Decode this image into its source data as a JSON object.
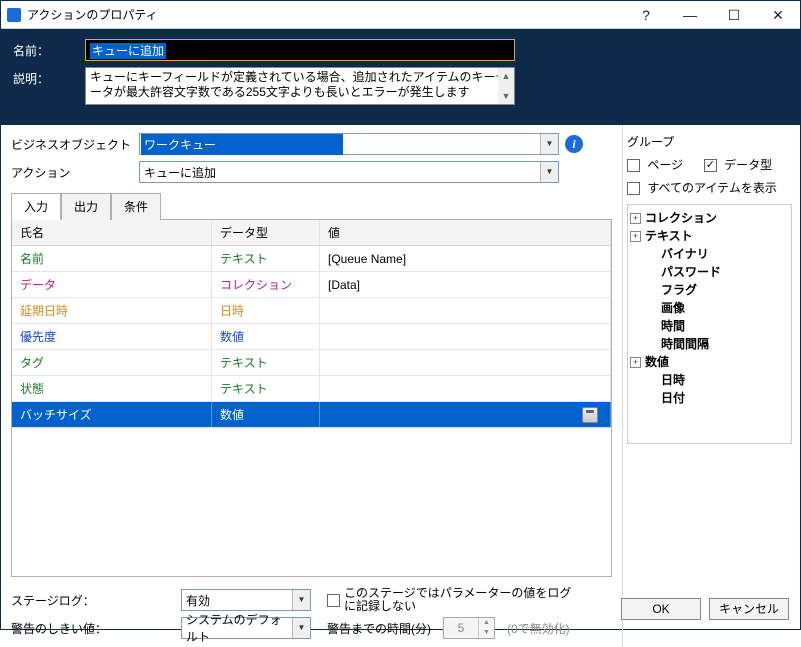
{
  "titlebar": {
    "title": "アクションのプロパティ"
  },
  "header": {
    "name_label": "名前：",
    "name_value": "キューに追加",
    "desc_label": "説明：",
    "desc_value": "キューにキーフィールドが定義されている場合、追加されたアイテムのキーデータが最大許容文字数である255文字よりも長いとエラーが発生します"
  },
  "form": {
    "business_object_label": "ビジネスオブジェクト",
    "business_object_value": "ワークキュー",
    "action_label": "アクション",
    "action_value": "キューに追加"
  },
  "tabs": {
    "input": "入力",
    "output": "出力",
    "condition": "条件"
  },
  "grid": {
    "col_name": "氏名",
    "col_type": "データ型",
    "col_value": "値",
    "rows": [
      {
        "name": "名前",
        "type": "テキスト",
        "value": "[Queue Name]",
        "name_class": "green",
        "type_class": "green"
      },
      {
        "name": "データ",
        "type": "コレクション",
        "value": "[Data]",
        "name_class": "magenta",
        "type_class": "magenta"
      },
      {
        "name": "延期日時",
        "type": "日時",
        "value": "",
        "name_class": "orange",
        "type_class": "orange"
      },
      {
        "name": "優先度",
        "type": "数値",
        "value": "",
        "name_class": "blue",
        "type_class": "blue"
      },
      {
        "name": "タグ",
        "type": "テキスト",
        "value": "",
        "name_class": "green",
        "type_class": "green"
      },
      {
        "name": "状態",
        "type": "テキスト",
        "value": "",
        "name_class": "green",
        "type_class": "green"
      },
      {
        "name": "バッチサイズ",
        "type": "数値",
        "value": "",
        "selected": true
      }
    ]
  },
  "bottom": {
    "stage_log_label": "ステージログ：",
    "stage_log_value": "有効",
    "stage_log_chk_label": "このステージではパラメーターの値をログに記録しない",
    "threshold_label": "警告のしきい値：",
    "threshold_value": "システムのデフォルト",
    "time_label": "警告までの時間(分)",
    "time_value": "5",
    "disable_hint": "(0で無効化)"
  },
  "right": {
    "group_label": "グループ",
    "page_label": "ページ",
    "datatype_label": "データ型",
    "show_all_label": "すべてのアイテムを表示",
    "tree": [
      {
        "label": "コレクション",
        "exp": "+",
        "bold": true
      },
      {
        "label": "テキスト",
        "exp": "+",
        "bold": true
      },
      {
        "label": "バイナリ",
        "indent": 1,
        "bold": true
      },
      {
        "label": "パスワード",
        "indent": 1,
        "bold": true
      },
      {
        "label": "フラグ",
        "indent": 1,
        "bold": true
      },
      {
        "label": "画像",
        "indent": 1,
        "bold": true
      },
      {
        "label": "時間",
        "indent": 1,
        "bold": true
      },
      {
        "label": "時間間隔",
        "indent": 1,
        "bold": true
      },
      {
        "label": "数値",
        "exp": "+",
        "bold": true
      },
      {
        "label": "日時",
        "indent": 1,
        "bold": true
      },
      {
        "label": "日付",
        "indent": 1,
        "bold": true
      }
    ]
  },
  "buttons": {
    "ok": "OK",
    "cancel": "キャンセル"
  }
}
